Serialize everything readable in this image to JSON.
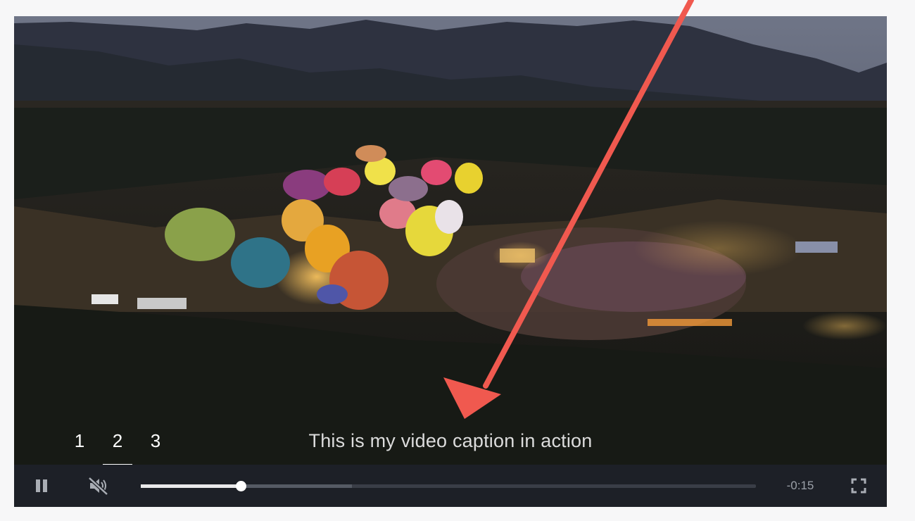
{
  "video": {
    "caption": "This is my video caption in action",
    "scene_description_icon": "hot-air-balloon-festival-aerial"
  },
  "chapters": [
    {
      "label": "1",
      "active": false
    },
    {
      "label": "2",
      "active": true
    },
    {
      "label": "3",
      "active": false
    }
  ],
  "controls": {
    "pause_icon": "pause-icon",
    "mute_icon": "muted-speaker-icon",
    "fullscreen_icon": "fullscreen-icon",
    "progress_played_fraction": 0.163,
    "progress_buffered_fraction": 0.343,
    "time_remaining": "-0:15"
  },
  "colors": {
    "annotation_arrow": "#f0594f",
    "control_bar": "#1d2027"
  }
}
